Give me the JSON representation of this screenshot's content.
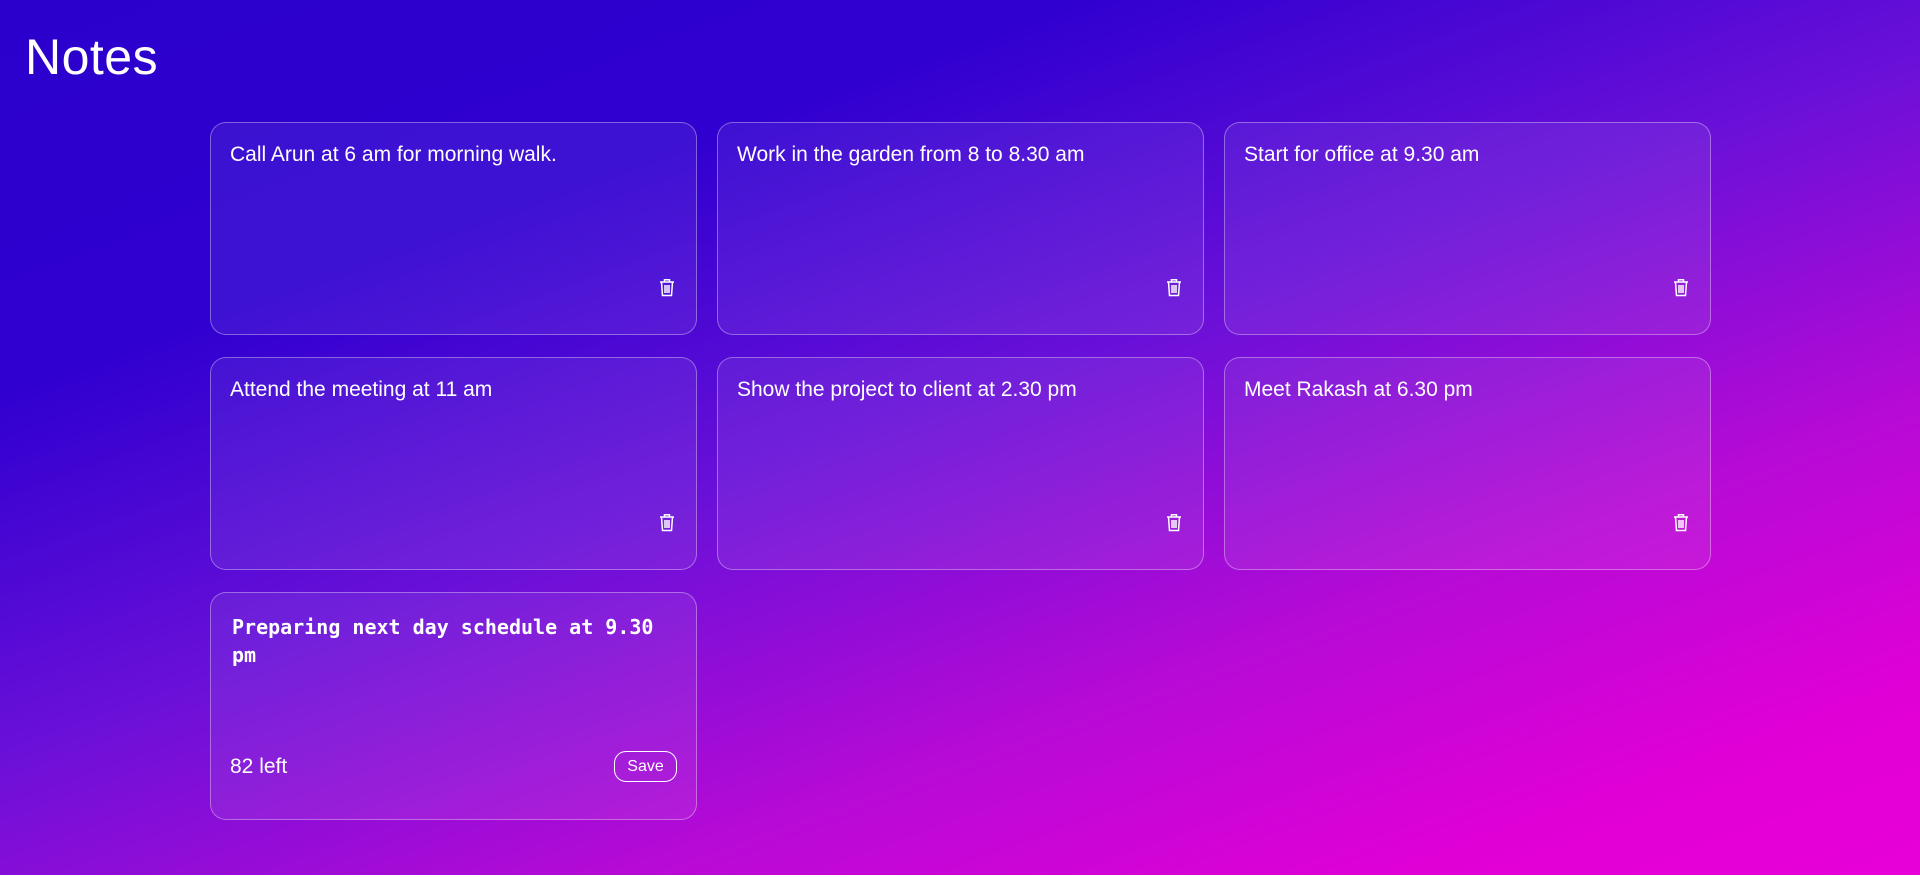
{
  "app": {
    "title": "Notes"
  },
  "notes": [
    {
      "text": "Call Arun at 6 am for morning walk.",
      "delete_icon": "trash-icon"
    },
    {
      "text": "Work in the garden from 8 to 8.30 am",
      "delete_icon": "trash-icon"
    },
    {
      "text": "Start for office at 9.30 am",
      "delete_icon": "trash-icon"
    },
    {
      "text": "Attend the meeting at 11 am",
      "delete_icon": "trash-icon"
    },
    {
      "text": "Show the project to client at 2.30 pm",
      "delete_icon": "trash-icon"
    },
    {
      "text": "Meet Rakash at 6.30 pm",
      "delete_icon": "trash-icon"
    }
  ],
  "new_note": {
    "value": "Preparing next day schedule at 9.30 pm",
    "remaining_text": "82 left",
    "save_label": "Save"
  },
  "colors": {
    "gradient_start": "#2b00cc",
    "gradient_end": "#e800d8",
    "text": "#ffffff"
  }
}
